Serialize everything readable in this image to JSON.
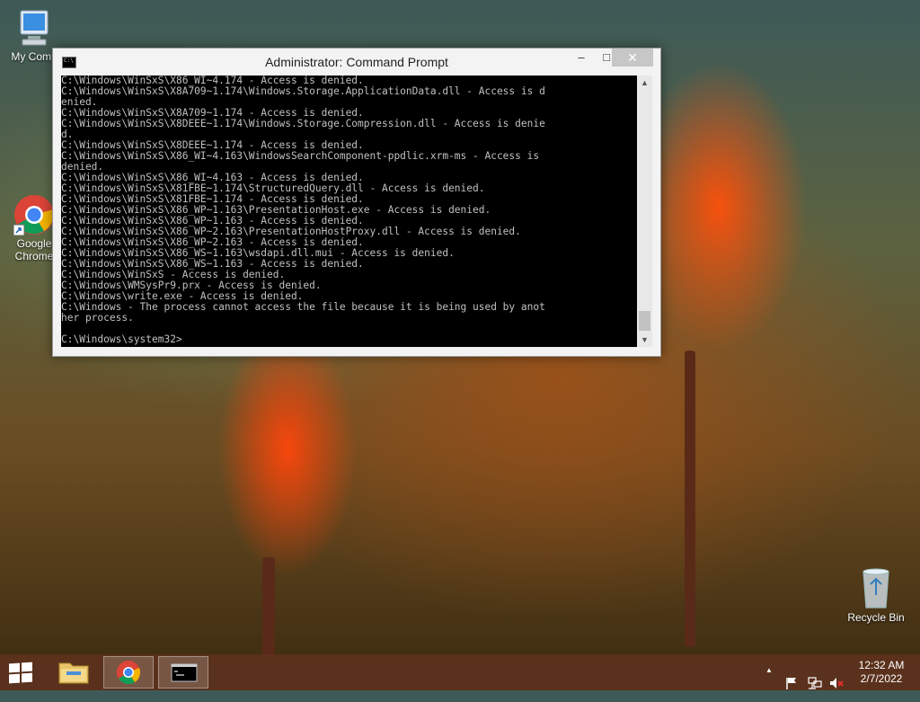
{
  "window": {
    "title": "Administrator: Command Prompt",
    "minimize_label": "–",
    "maximize_label": "□",
    "close_label": "✕"
  },
  "console_lines": [
    "C:\\Windows\\WinSxS\\X86_WI~4.174 - Access is denied.",
    "C:\\Windows\\WinSxS\\X8A709~1.174\\Windows.Storage.ApplicationData.dll - Access is d",
    "enied.",
    "C:\\Windows\\WinSxS\\X8A709~1.174 - Access is denied.",
    "C:\\Windows\\WinSxS\\X8DEEE~1.174\\Windows.Storage.Compression.dll - Access is denie",
    "d.",
    "C:\\Windows\\WinSxS\\X8DEEE~1.174 - Access is denied.",
    "C:\\Windows\\WinSxS\\X86_WI~4.163\\WindowsSearchComponent-ppdlic.xrm-ms - Access is",
    "denied.",
    "C:\\Windows\\WinSxS\\X86_WI~4.163 - Access is denied.",
    "C:\\Windows\\WinSxS\\X81FBE~1.174\\StructuredQuery.dll - Access is denied.",
    "C:\\Windows\\WinSxS\\X81FBE~1.174 - Access is denied.",
    "C:\\Windows\\WinSxS\\X86_WP~1.163\\PresentationHost.exe - Access is denied.",
    "C:\\Windows\\WinSxS\\X86_WP~1.163 - Access is denied.",
    "C:\\Windows\\WinSxS\\X86_WP~2.163\\PresentationHostProxy.dll - Access is denied.",
    "C:\\Windows\\WinSxS\\X86_WP~2.163 - Access is denied.",
    "C:\\Windows\\WinSxS\\X86_WS~1.163\\wsdapi.dll.mui - Access is denied.",
    "C:\\Windows\\WinSxS\\X86_WS~1.163 - Access is denied.",
    "C:\\Windows\\WinSxS - Access is denied.",
    "C:\\Windows\\WMSysPr9.prx - Access is denied.",
    "C:\\Windows\\write.exe - Access is denied.",
    "C:\\Windows - The process cannot access the file because it is being used by anot",
    "her process.",
    "",
    "C:\\Windows\\system32>"
  ],
  "desktop_icons": {
    "my_computer": "My Comp",
    "chrome_line1": "Google",
    "chrome_line2": "Chrome",
    "recycle_bin": "Recycle Bin"
  },
  "taskbar": {
    "clock_time": "12:32 AM",
    "clock_date": "2/7/2022",
    "tray_up_arrow": "▲"
  },
  "colors": {
    "console_bg": "#000000",
    "console_fg": "#c0c0c0",
    "close_button": "#c7c7c7"
  }
}
